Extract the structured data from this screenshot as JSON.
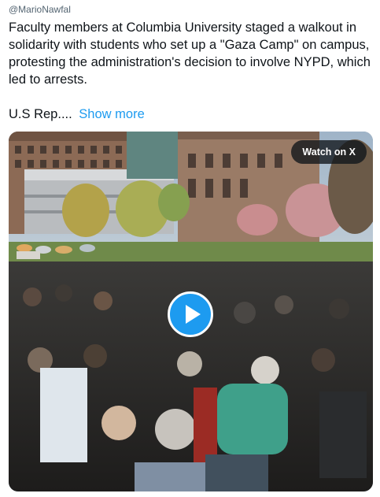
{
  "tweet": {
    "handle": "@MarioNawfal",
    "text": "Faculty members at Columbia University staged a walkout in solidarity with students who set up a \"Gaza Camp\" on campus, protesting the administration's decision to involve NYPD, which led to arrests.",
    "snippet": "U.S Rep....",
    "show_more_label": "Show more"
  },
  "video": {
    "watch_label": "Watch on X",
    "play_icon": "play-icon",
    "accent": "#1d9bf0"
  }
}
